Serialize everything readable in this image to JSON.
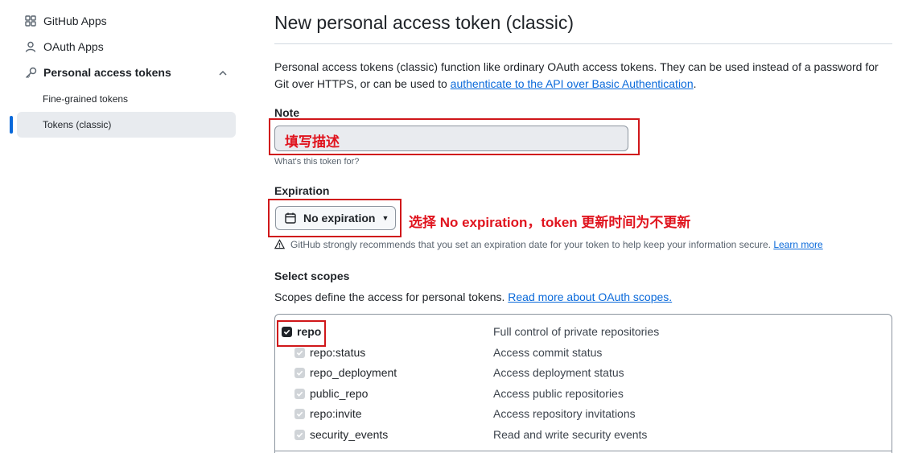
{
  "sidebar": {
    "items": [
      {
        "label": "GitHub Apps",
        "icon": "apps-icon"
      },
      {
        "label": "OAuth Apps",
        "icon": "person-icon"
      },
      {
        "label": "Personal access tokens",
        "icon": "key-icon"
      }
    ],
    "sub_items": [
      {
        "label": "Fine-grained tokens"
      },
      {
        "label": "Tokens (classic)",
        "active": true
      }
    ]
  },
  "main": {
    "title": "New personal access token (classic)",
    "intro_text": "Personal access tokens (classic) function like ordinary OAuth access tokens. They can be used instead of a password for Git over HTTPS, or can be used to ",
    "intro_link": "authenticate to the API over Basic Authentication",
    "intro_end": ".",
    "note": {
      "label": "Note",
      "value": "填写描述",
      "hint": "What's this token for?"
    },
    "expiration": {
      "label": "Expiration",
      "selected": "No expiration",
      "warning": "GitHub strongly recommends that you set an expiration date for your token to help keep your information secure.",
      "warning_link": "Learn more"
    },
    "scopes": {
      "label": "Select scopes",
      "desc": "Scopes define the access for personal tokens. ",
      "desc_link": "Read more about OAuth scopes.",
      "items": [
        {
          "name": "repo",
          "desc": "Full control of private repositories",
          "checked": true
        },
        {
          "name": "repo:status",
          "desc": "Access commit status",
          "checked": true
        },
        {
          "name": "repo_deployment",
          "desc": "Access deployment status",
          "checked": true
        },
        {
          "name": "public_repo",
          "desc": "Access public repositories",
          "checked": true
        },
        {
          "name": "repo:invite",
          "desc": "Access repository invitations",
          "checked": true
        },
        {
          "name": "security_events",
          "desc": "Read and write security events",
          "checked": true
        }
      ]
    }
  },
  "annotations": {
    "expiration_note": "选择 No expiration，token 更新时间为不更新"
  },
  "colors": {
    "accent": "#0969da",
    "annotation_red": "#e0141e"
  }
}
